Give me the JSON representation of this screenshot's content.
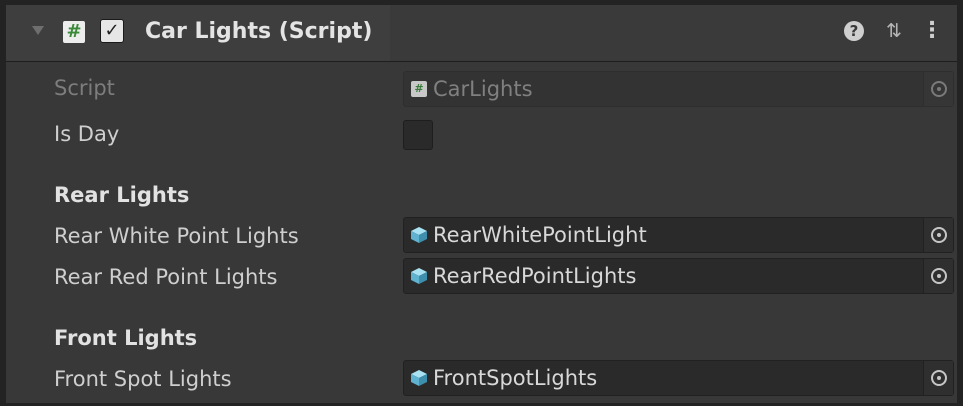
{
  "header": {
    "title": "Car Lights (Script)",
    "enabled": true,
    "toggle_glyph": "✓",
    "script_glyph": "#",
    "help_glyph": "?",
    "presets_glyph": "⇅",
    "menu_glyph": "⋮"
  },
  "fields": {
    "script": {
      "label": "Script",
      "value": "CarLights",
      "icon": "script-icon"
    },
    "is_day": {
      "label": "Is Day",
      "checked": false
    }
  },
  "sections": {
    "rear": {
      "heading": "Rear Lights",
      "white": {
        "label": "Rear White Point Lights",
        "value": "RearWhitePointLight",
        "icon": "prefab-cube-icon"
      },
      "red": {
        "label": "Rear Red Point Lights",
        "value": "RearRedPointLights",
        "icon": "prefab-cube-icon"
      }
    },
    "front": {
      "heading": "Front Lights",
      "spot": {
        "label": "Front Spot Lights",
        "value": "FrontSpotLights",
        "icon": "prefab-cube-icon"
      }
    }
  },
  "colors": {
    "background": "#383838",
    "header": "#3e3e3e",
    "field": "#2a2a2a",
    "script_icon_green": "#3a8a3a",
    "prefab_blue": "#7ecbe6"
  }
}
